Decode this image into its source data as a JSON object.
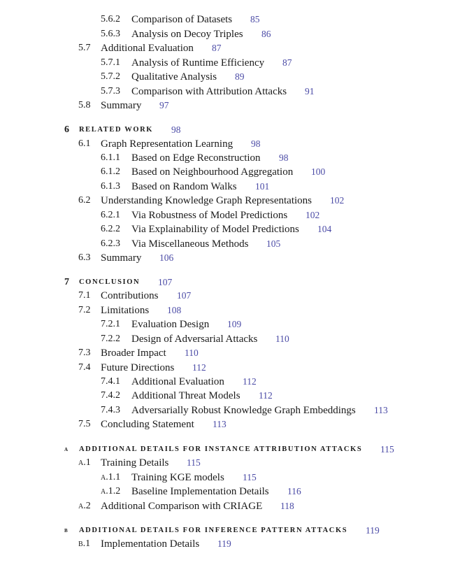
{
  "toc": [
    {
      "level": 3,
      "num": "5.6.2",
      "title": "Comparison of Datasets",
      "page": "85"
    },
    {
      "level": 3,
      "num": "5.6.3",
      "title": "Analysis on Decoy Triples",
      "page": "86"
    },
    {
      "level": 2,
      "num": "5.7",
      "title": "Additional Evaluation",
      "page": "87"
    },
    {
      "level": 3,
      "num": "5.7.1",
      "title": "Analysis of Runtime Efficiency",
      "page": "87"
    },
    {
      "level": 3,
      "num": "5.7.2",
      "title": "Qualitative Analysis",
      "page": "89"
    },
    {
      "level": 3,
      "num": "5.7.3",
      "title": "Comparison with Attribution Attacks",
      "page": "91"
    },
    {
      "level": 2,
      "num": "5.8",
      "title": "Summary",
      "page": "97"
    },
    {
      "level": 1,
      "num": "6",
      "title": "Related Work",
      "page": "98"
    },
    {
      "level": 2,
      "num": "6.1",
      "title": "Graph Representation Learning",
      "page": "98"
    },
    {
      "level": 3,
      "num": "6.1.1",
      "title": "Based on Edge Reconstruction",
      "page": "98"
    },
    {
      "level": 3,
      "num": "6.1.2",
      "title": "Based on Neighbourhood Aggregation",
      "page": "100"
    },
    {
      "level": 3,
      "num": "6.1.3",
      "title": "Based on Random Walks",
      "page": "101"
    },
    {
      "level": 2,
      "num": "6.2",
      "title": "Understanding Knowledge Graph Representations",
      "page": "102"
    },
    {
      "level": 3,
      "num": "6.2.1",
      "title": "Via Robustness of Model Predictions",
      "page": "102"
    },
    {
      "level": 3,
      "num": "6.2.2",
      "title": "Via Explainability of Model Predictions",
      "page": "104"
    },
    {
      "level": 3,
      "num": "6.2.3",
      "title": "Via Miscellaneous Methods",
      "page": "105"
    },
    {
      "level": 2,
      "num": "6.3",
      "title": "Summary",
      "page": "106"
    },
    {
      "level": 1,
      "num": "7",
      "title": "Conclusion",
      "page": "107"
    },
    {
      "level": 2,
      "num": "7.1",
      "title": "Contributions",
      "page": "107"
    },
    {
      "level": 2,
      "num": "7.2",
      "title": "Limitations",
      "page": "108"
    },
    {
      "level": 3,
      "num": "7.2.1",
      "title": "Evaluation Design",
      "page": "109"
    },
    {
      "level": 3,
      "num": "7.2.2",
      "title": "Design of Adversarial Attacks",
      "page": "110"
    },
    {
      "level": 2,
      "num": "7.3",
      "title": "Broader Impact",
      "page": "110"
    },
    {
      "level": 2,
      "num": "7.4",
      "title": "Future Directions",
      "page": "112"
    },
    {
      "level": 3,
      "num": "7.4.1",
      "title": "Additional Evaluation",
      "page": "112"
    },
    {
      "level": 3,
      "num": "7.4.2",
      "title": "Additional Threat Models",
      "page": "112"
    },
    {
      "level": 3,
      "num": "7.4.3",
      "title": "Adversarially Robust Knowledge Graph Embeddings",
      "page": "113"
    },
    {
      "level": 2,
      "num": "7.5",
      "title": "Concluding Statement",
      "page": "113"
    },
    {
      "level": 1,
      "num": "A",
      "title": "Additional Details for Instance Attribution Attacks",
      "page": "115"
    },
    {
      "level": 2,
      "num": "A.1",
      "title": "Training Details",
      "page": "115"
    },
    {
      "level": 3,
      "num": "A.1.1",
      "title": "Training KGE models",
      "page": "115"
    },
    {
      "level": 3,
      "num": "A.1.2",
      "title": "Baseline Implementation Details",
      "page": "116"
    },
    {
      "level": 2,
      "num": "A.2",
      "title": "Additional Comparison with CRIAGE",
      "page": "118"
    },
    {
      "level": 1,
      "num": "B",
      "title": "Additional Details for Inference Pattern Attacks",
      "page": "119"
    },
    {
      "level": 2,
      "num": "B.1",
      "title": "Implementation Details",
      "page": "119"
    }
  ],
  "colors": {
    "text": "#1a1a1a",
    "page_number": "#4b4ba6"
  }
}
